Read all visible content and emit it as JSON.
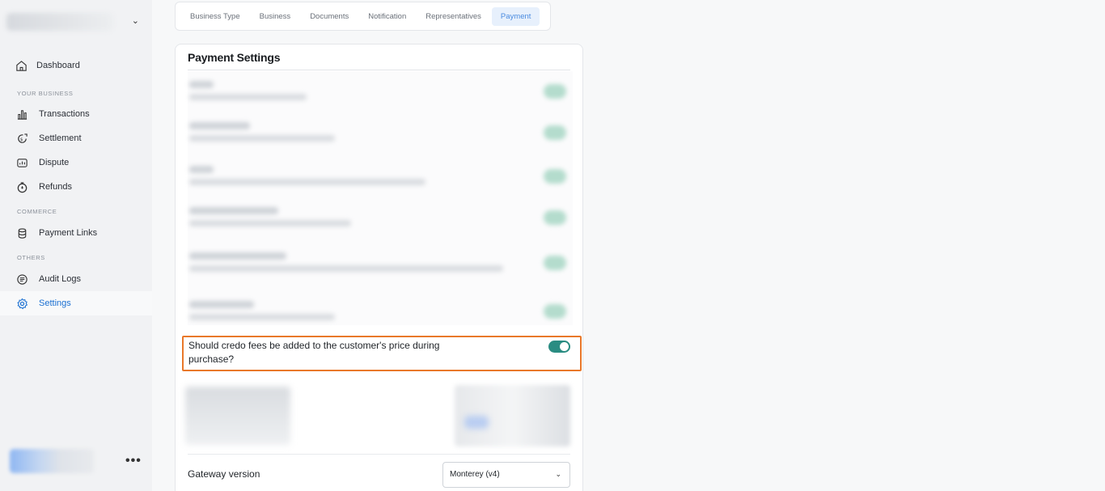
{
  "sidebar": {
    "nav": {
      "dashboard": "Dashboard",
      "your_business_label": "YOUR BUSINESS",
      "transactions": "Transactions",
      "settlement": "Settlement",
      "dispute": "Dispute",
      "refunds": "Refunds",
      "commerce_label": "COMMERCE",
      "payment_links": "Payment Links",
      "others_label": "OTHERS",
      "audit_logs": "Audit Logs",
      "settings": "Settings"
    },
    "more_menu": "•••"
  },
  "tabs": {
    "items": [
      "Business Type",
      "Business",
      "Documents",
      "Notification",
      "Representatives",
      "Payment"
    ],
    "active": "Payment"
  },
  "payment_settings": {
    "title": "Payment Settings",
    "fee_question": "Should credo fees be added to the customer's price during purchase?",
    "fee_toggle_on": true,
    "gateway_label": "Gateway version",
    "gateway_value": "Monterey (v4)"
  },
  "colors": {
    "accent": "#1a6fd1",
    "toggle_on": "#2a8c82",
    "highlight": "#e9782a"
  }
}
